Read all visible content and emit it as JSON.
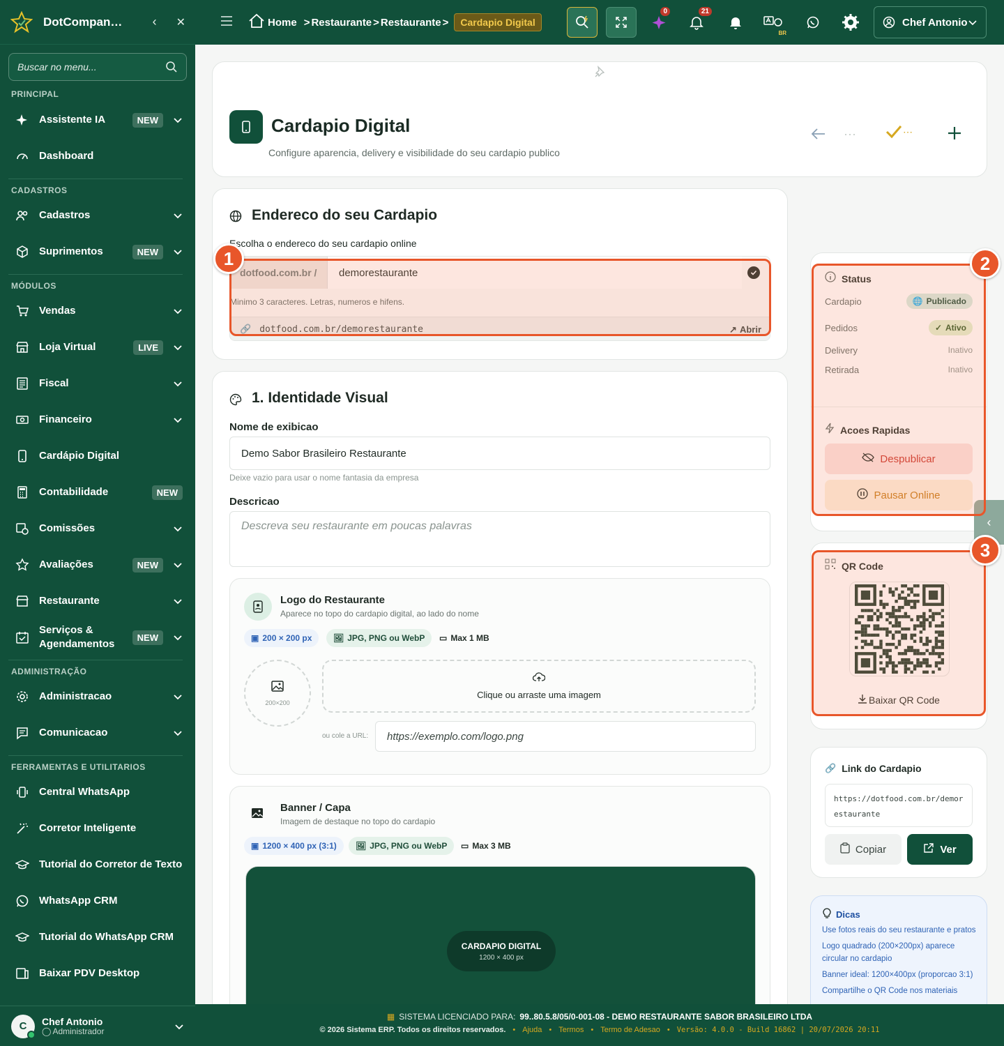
{
  "sidebar": {
    "title": "DotCompan…",
    "search_placeholder": "Buscar no menu...",
    "sections": {
      "principal": "PRINCIPAL",
      "cadastros": "CADASTROS",
      "modulos": "MÓDULOS",
      "administracao": "ADMINISTRAÇÃO",
      "ferramentas": "FERRAMENTAS E UTILITARIOS"
    },
    "items": [
      {
        "label": "Assistente IA",
        "badge": "NEW"
      },
      {
        "label": "Dashboard"
      },
      {
        "label": "Cadastros"
      },
      {
        "label": "Suprimentos",
        "badge": "NEW"
      },
      {
        "label": "Vendas"
      },
      {
        "label": "Loja Virtual",
        "badge": "LIVE"
      },
      {
        "label": "Fiscal"
      },
      {
        "label": "Financeiro"
      },
      {
        "label": "Cardápio Digital"
      },
      {
        "label": "Contabilidade",
        "badge": "NEW"
      },
      {
        "label": "Comissões"
      },
      {
        "label": "Avaliações",
        "badge": "NEW"
      },
      {
        "label": "Restaurante"
      },
      {
        "label": "Serviços & Agendamentos",
        "badge": "NEW"
      },
      {
        "label": "Administracao"
      },
      {
        "label": "Comunicacao"
      },
      {
        "label": "Central WhatsApp"
      },
      {
        "label": "Corretor Inteligente"
      },
      {
        "label": "Tutorial do Corretor de Texto"
      },
      {
        "label": "WhatsApp CRM"
      },
      {
        "label": "Tutorial do WhatsApp CRM"
      },
      {
        "label": "Baixar PDV Desktop"
      }
    ],
    "user": {
      "initial": "C",
      "name": "Chef Antonio",
      "role": "Administrador"
    }
  },
  "topbar": {
    "breadcrumb": [
      "Home",
      "Restaurante",
      "Restaurante"
    ],
    "current": "Cardapio Digital",
    "badges": {
      "sparkle": "0",
      "bell": "21"
    },
    "lang": "BR",
    "user": "Chef Antonio"
  },
  "header": {
    "title": "Cardapio Digital",
    "subtitle": "Configure aparencia, delivery e visibilidade do seu cardapio publico"
  },
  "address": {
    "title": "Endereco do seu Cardapio",
    "label": "Escolha o endereco do seu cardapio online",
    "prefix": "dotfood.com.br /",
    "slug": "demorestaurante",
    "hint": "Minimo 3 caracteres. Letras, numeros e hifens.",
    "url": "dotfood.com.br/demorestaurante",
    "open": "Abrir"
  },
  "identity": {
    "title": "1. Identidade Visual",
    "name_label": "Nome de exibicao",
    "name_value": "Demo Sabor Brasileiro Restaurante",
    "name_hint": "Deixe vazio para usar o nome fantasia da empresa",
    "desc_label": "Descricao",
    "desc_placeholder": "Descreva seu restaurante em poucas palavras",
    "logo": {
      "title": "Logo do Restaurante",
      "subtitle": "Aparece no topo do cardapio digital, ao lado do nome",
      "chips": [
        "200 × 200 px",
        "JPG, PNG ou WebP",
        "Max 1 MB"
      ],
      "preview_size": "200×200",
      "drop_text": "Clique ou arraste uma imagem",
      "url_label": "ou cole a URL:",
      "url_placeholder": "https://exemplo.com/logo.png"
    },
    "banner": {
      "title": "Banner / Capa",
      "subtitle": "Imagem de destaque no topo do cardapio",
      "chips": [
        "1200 × 400 px (3:1)",
        "JPG, PNG ou WebP",
        "Max 3 MB"
      ],
      "preview_title": "CARDAPIO DIGITAL",
      "preview_size": "1200 × 400 px"
    }
  },
  "status": {
    "title": "Status",
    "rows": [
      {
        "label": "Cardapio",
        "value": "Publicado"
      },
      {
        "label": "Pedidos",
        "value": "Ativo"
      },
      {
        "label": "Delivery",
        "value": "Inativo"
      },
      {
        "label": "Retirada",
        "value": "Inativo"
      }
    ]
  },
  "quick": {
    "title": "Acoes Rapidas",
    "unpublish": "Despublicar",
    "pause": "Pausar Online"
  },
  "qr": {
    "title": "QR Code",
    "download": "Baixar QR Code"
  },
  "link": {
    "title": "Link do Cardapio",
    "url": "https://dotfood.com.br/demorestaurante",
    "copy": "Copiar",
    "view": "Ver"
  },
  "tips": {
    "title": "Dicas",
    "items": [
      "Use fotos reais do seu restaurante e pratos",
      "Logo quadrado (200×200px) aparece circular no cardapio",
      "Banner ideal: 1200×400px (proporcao 3:1)",
      "Compartilhe o QR Code nos materiais"
    ]
  },
  "markers": [
    "1",
    "2",
    "3"
  ],
  "footer": {
    "license_prefix": "SISTEMA LICENCIADO PARA:",
    "license": "99..80.5.8/05/0-001-08 - DEMO RESTAURANTE SABOR BRASILEIRO LTDA",
    "copyright": "© 2026 Sistema ERP. Todos os direitos reservados.",
    "links": [
      "Ajuda",
      "Termos",
      "Termo de Adesao"
    ],
    "version": "Versão: 4.0.0 - Build 16862 | 20/07/2026 20:11"
  },
  "colors": {
    "primary": "#11503a",
    "accent": "#e8562a",
    "gold": "#f2c94c"
  }
}
